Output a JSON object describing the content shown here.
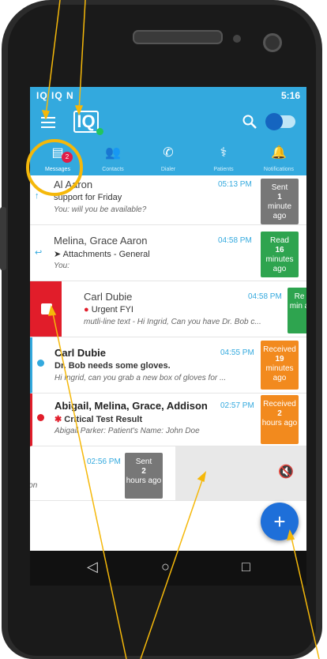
{
  "status": {
    "left_icons": "IQ IQ N",
    "time": "5:16"
  },
  "tabs": [
    {
      "label": "Messages",
      "badge": "2"
    },
    {
      "label": "Contacts"
    },
    {
      "label": "Dialer"
    },
    {
      "label": "Patients"
    },
    {
      "label": "Notifications"
    }
  ],
  "rows": [
    {
      "name": "Al Aaron",
      "time": "05:13 PM",
      "subject": "support for Friday",
      "preview": "You: will you be available?",
      "status": {
        "state": "Sent",
        "n": "1",
        "unit": "minute ago"
      }
    },
    {
      "name": "Melina, Grace Aaron",
      "time": "04:58 PM",
      "subject": "Attachments - General",
      "preview": "You:",
      "status": {
        "state": "Read",
        "n": "16",
        "unit": "minutes ago"
      }
    },
    {
      "name": "Carl Dubie",
      "time": "04:58 PM",
      "subject": "Urgent FYI",
      "preview": "mutli-line text - Hi Ingrid, Can you have Dr. Bob c...",
      "status": {
        "state": "Re",
        "n": "",
        "unit": "min a"
      }
    },
    {
      "name": "Carl Dubie",
      "time": "04:55 PM",
      "subject": "Dr. Bob needs some gloves.",
      "preview": "Hi Ingrid, can you grab a new box of gloves for ...",
      "status": {
        "state": "Received",
        "n": "19",
        "unit": "minutes ago"
      }
    },
    {
      "name": "Abigail, Melina, Grace, Addison",
      "time": "02:57 PM",
      "subject": "Critical Test Result",
      "preview": "Abigail Parker: Patient's Name: John Doe",
      "status": {
        "state": "Received",
        "n": "2",
        "unit": "hours ago"
      }
    },
    {
      "name": "",
      "time": "02:56 PM",
      "subject": "",
      "preview": "ion",
      "status": {
        "state": "Sent",
        "n": "2",
        "unit": "hours ago"
      }
    }
  ],
  "fab": "+",
  "colors": {
    "brand": "#33a9de",
    "sent": "#777777",
    "read": "#2ea44f",
    "received": "#f28a1e",
    "annotation": "#f5b80a"
  }
}
